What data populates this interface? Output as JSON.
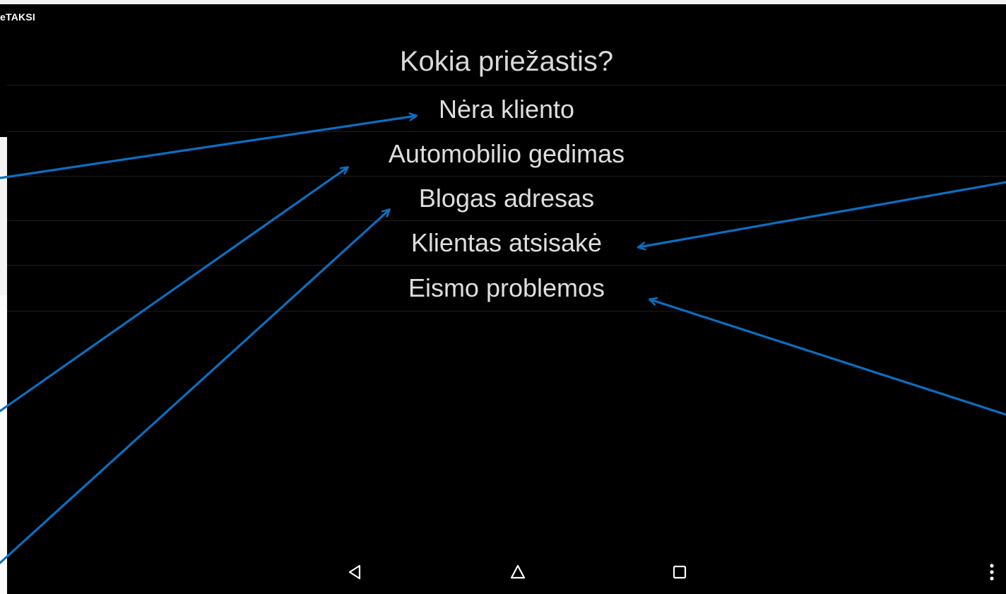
{
  "app": {
    "name": "eTAKSI"
  },
  "dialog": {
    "title": "Kokia priežastis?",
    "reasons": [
      "Nėra kliento",
      "Automobilio gedimas",
      "Blogas adresas",
      "Klientas atsisakė",
      "Eismo problemos"
    ]
  },
  "navbar": {
    "icons": [
      "back-icon",
      "home-icon",
      "recent-apps-icon",
      "overflow-menu-icon"
    ]
  },
  "colors": {
    "background": "#000000",
    "text": "#dedede",
    "annotation_arrow": "#0a6fc2"
  }
}
